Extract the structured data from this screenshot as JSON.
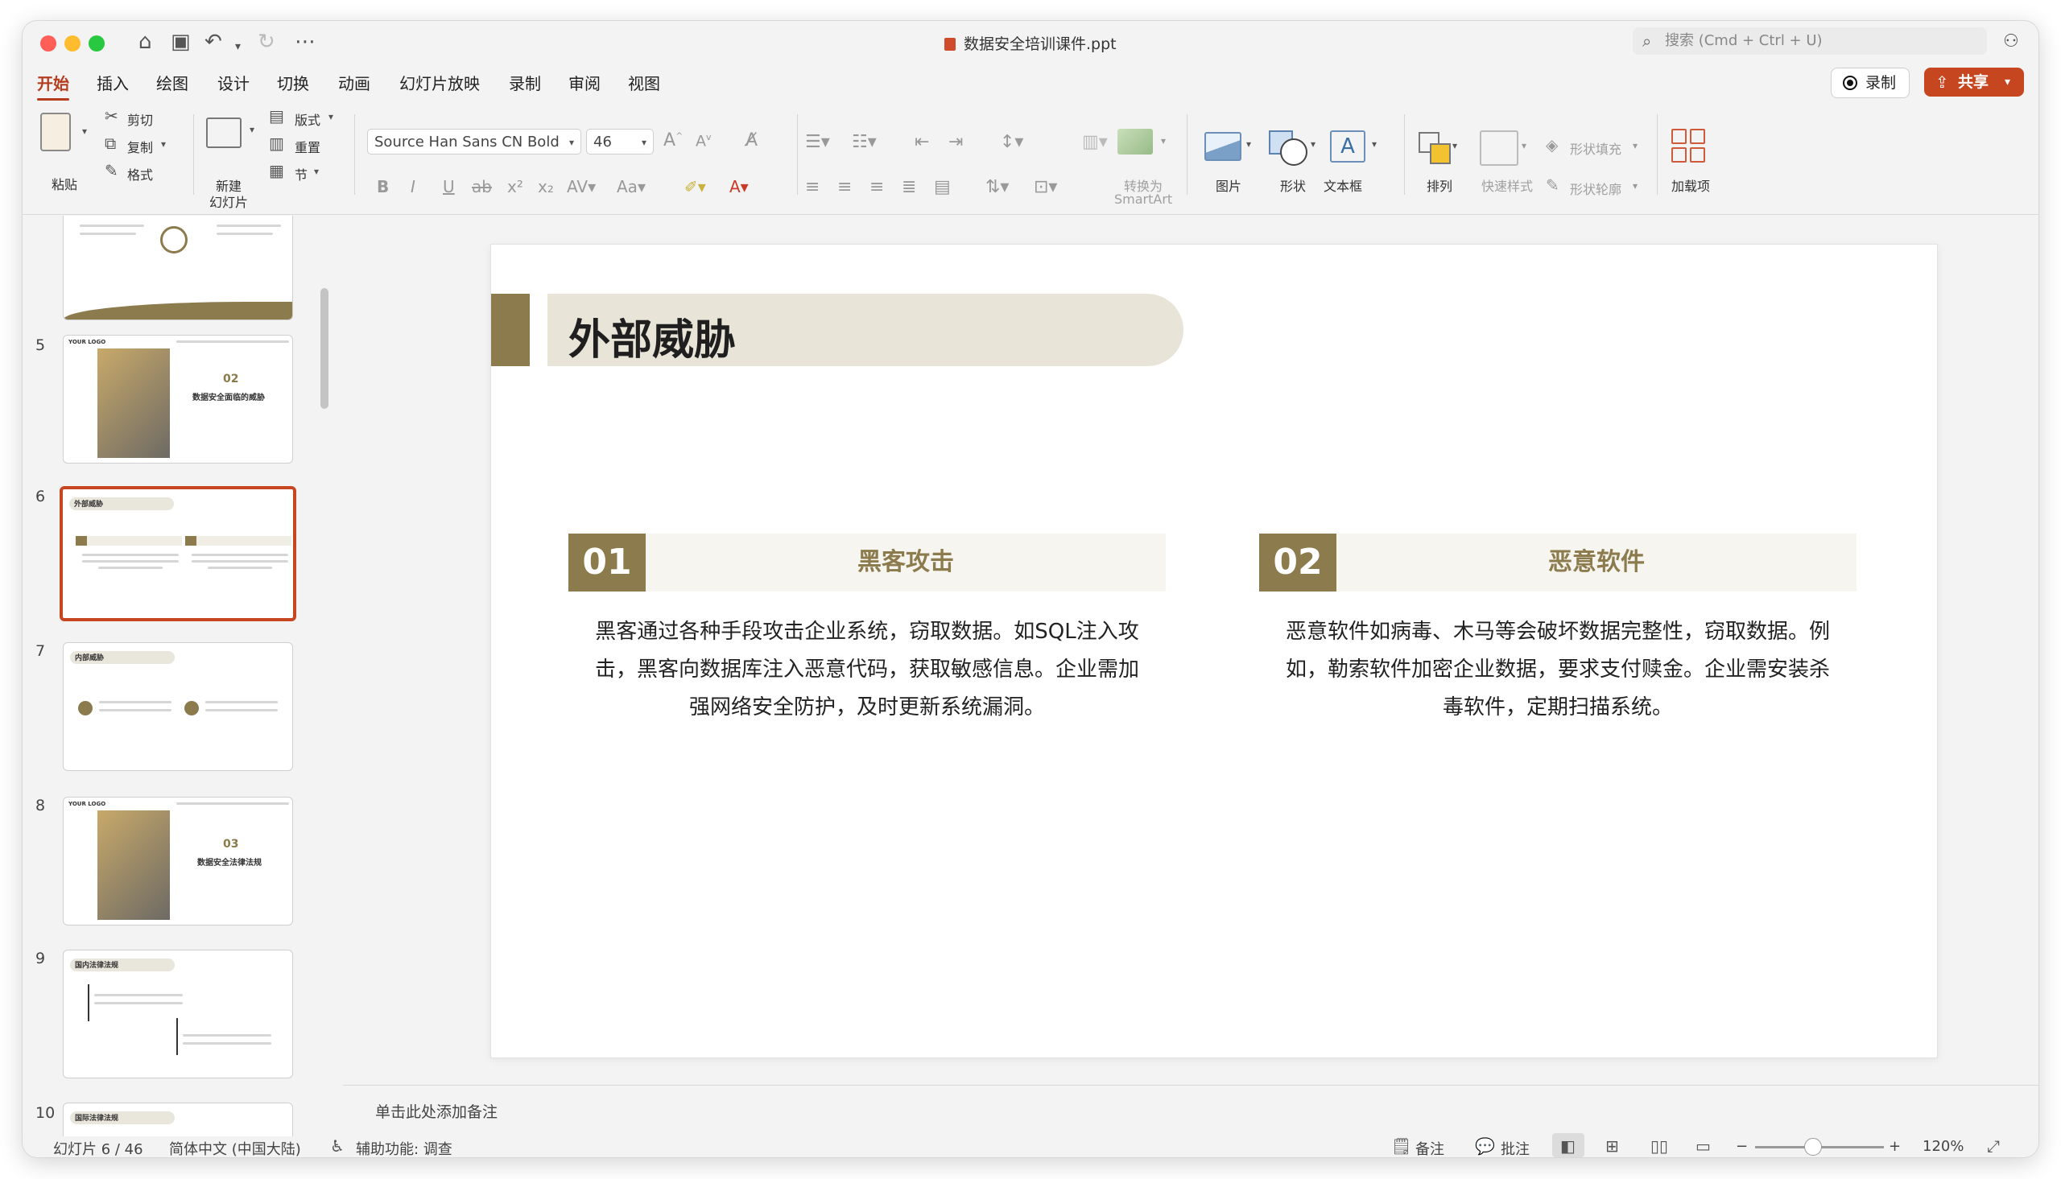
{
  "window": {
    "title": "数据安全培训课件.ppt",
    "search_placeholder": "搜索 (Cmd + Ctrl + U)"
  },
  "toolbar_icons": [
    "home-icon",
    "save-icon",
    "undo-icon",
    "redo-icon",
    "more-icon"
  ],
  "tabs": [
    {
      "label": "开始",
      "active": true
    },
    {
      "label": "插入"
    },
    {
      "label": "绘图"
    },
    {
      "label": "设计"
    },
    {
      "label": "切换"
    },
    {
      "label": "动画"
    },
    {
      "label": "幻灯片放映"
    },
    {
      "label": "录制"
    },
    {
      "label": "审阅"
    },
    {
      "label": "视图"
    }
  ],
  "actions": {
    "record_label": "录制",
    "share_label": "共享"
  },
  "ribbon": {
    "paste": "粘贴",
    "cut": "剪切",
    "copy": "复制",
    "format": "格式",
    "new_slide": "新建",
    "new_slide_2": "幻灯片",
    "layout": "版式",
    "reset": "重置",
    "section": "节",
    "font_name": "Source Han Sans CN Bold",
    "font_size": "46",
    "smartart_1": "转换为",
    "smartart_2": "SmartArt",
    "picture": "图片",
    "shape": "形状",
    "textbox": "文本框",
    "arrange": "排列",
    "quick_styles": "快速样式",
    "shape_fill": "形状填充",
    "shape_outline": "形状轮廓",
    "addins": "加载项"
  },
  "thumbnails": [
    {
      "number": "5",
      "big": "02",
      "caption": "数据安全面临的威胁",
      "logo": "YOUR LOGO"
    },
    {
      "number": "6",
      "title": "外部威胁",
      "selected": true
    },
    {
      "number": "7",
      "title": "内部威胁"
    },
    {
      "number": "8",
      "big": "03",
      "caption": "数据安全法律法规",
      "logo": "YOUR LOGO"
    },
    {
      "number": "9",
      "title": "国内法律法规"
    },
    {
      "number": "10",
      "title": "国际法律法规"
    }
  ],
  "slide": {
    "title": "外部威胁",
    "cards": [
      {
        "num": "01",
        "label": "黑客攻击",
        "lines": [
          "黑客通过各种手段攻击企业系统，窃取数据。如SQL注入攻",
          "击，黑客向数据库注入恶意代码，获取敏感信息。企业需加",
          "强网络安全防护，及时更新系统漏洞。"
        ]
      },
      {
        "num": "02",
        "label": "恶意软件",
        "lines": [
          "恶意软件如病毒、木马等会破坏数据完整性，窃取数据。例",
          "如，勒索软件加密企业数据，要求支付赎金。企业需安装杀",
          "毒软件，定期扫描系统。"
        ]
      }
    ]
  },
  "notes_placeholder": "单击此处添加备注",
  "status": {
    "slide_counter": "幻灯片 6 / 46",
    "language": "简体中文 (中国大陆)",
    "accessibility": "辅助功能: 调查",
    "notes": "备注",
    "comments": "批注",
    "zoom": "120%",
    "zoom_level": 0.45
  },
  "colors": {
    "accent": "#c5461f",
    "theme": "#8c7b4d",
    "theme_light": "#e8e4d8"
  }
}
